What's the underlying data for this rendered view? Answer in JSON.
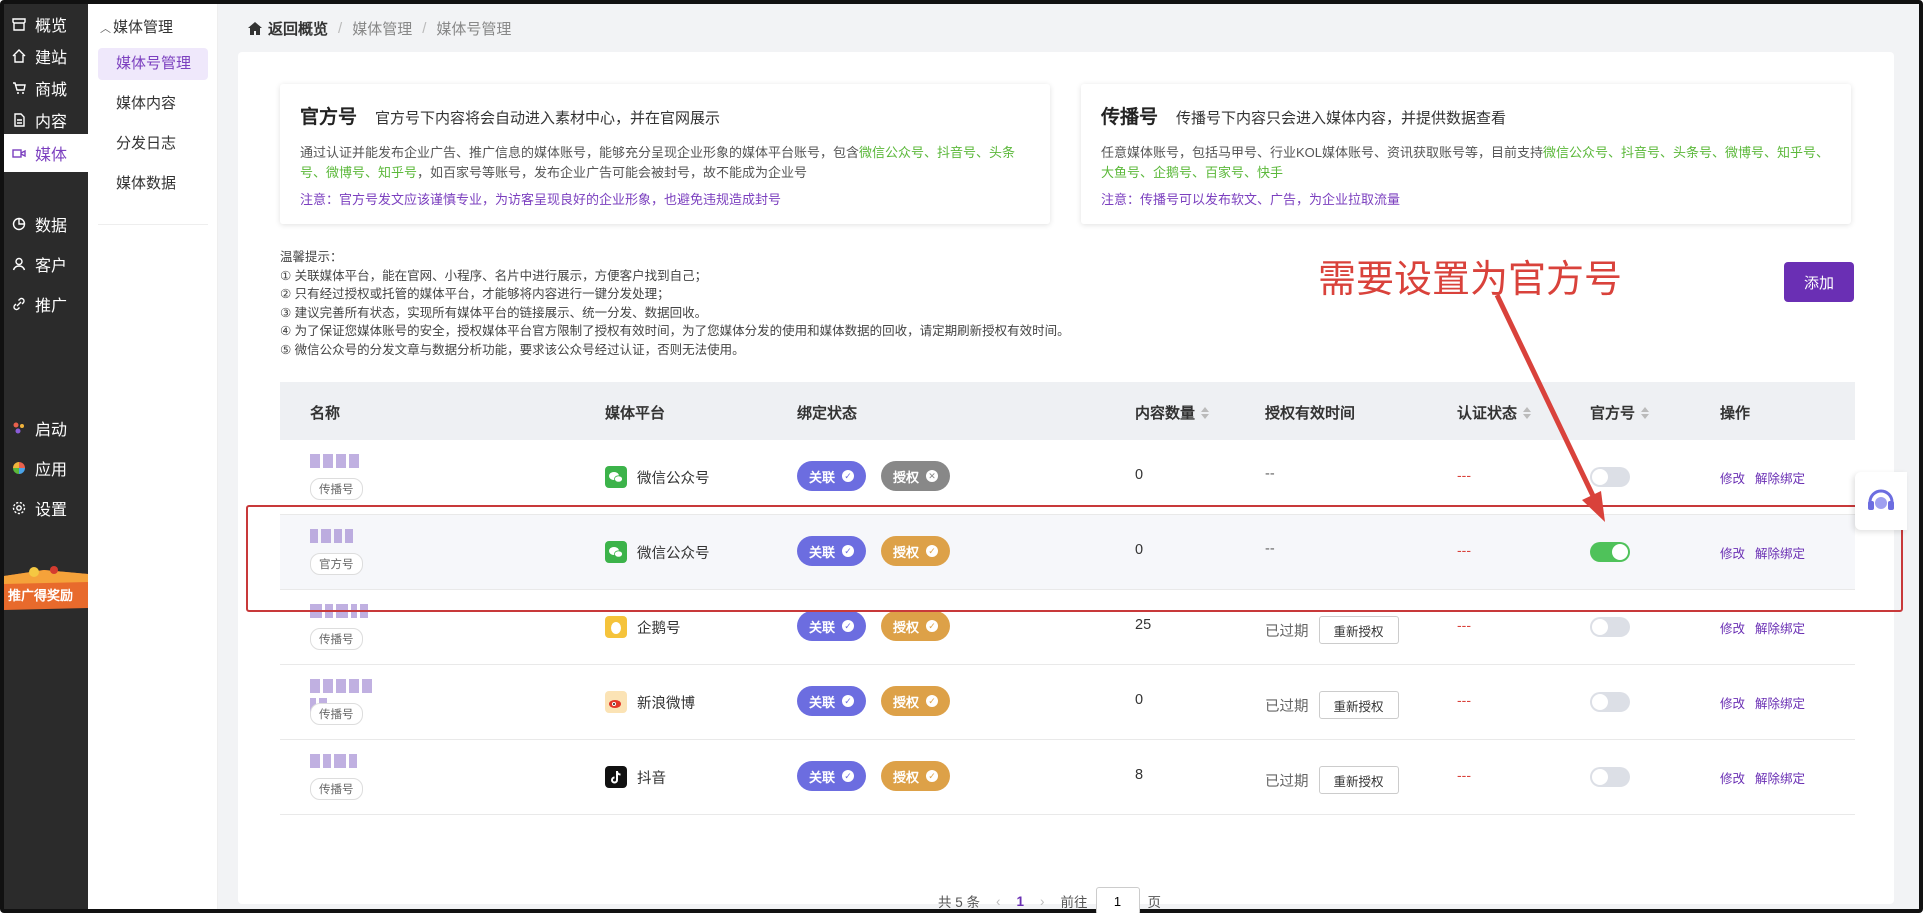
{
  "sidebar": {
    "items": [
      {
        "label": "概览",
        "icon": "storefront-icon"
      },
      {
        "label": "建站",
        "icon": "home-icon"
      },
      {
        "label": "商城",
        "icon": "cart-icon"
      },
      {
        "label": "内容",
        "icon": "document-icon"
      },
      {
        "label": "媒体",
        "icon": "video-icon",
        "active": true
      },
      {
        "label": "数据",
        "icon": "pie-chart-icon"
      },
      {
        "label": "客户",
        "icon": "user-icon"
      },
      {
        "label": "推广",
        "icon": "link-icon"
      }
    ],
    "bottom_items": [
      {
        "label": "启动",
        "icon": "launch-icon"
      },
      {
        "label": "应用",
        "icon": "apps-icon"
      },
      {
        "label": "设置",
        "icon": "gear-icon"
      }
    ],
    "promo_text": "推广得奖励"
  },
  "submenu": {
    "header": "媒体管理",
    "items": [
      "媒体号管理",
      "媒体内容",
      "分发日志",
      "媒体数据"
    ]
  },
  "breadcrumb": {
    "home": "返回概览",
    "level1": "媒体管理",
    "level2": "媒体号管理"
  },
  "cards": {
    "official": {
      "title": "官方号",
      "subtitle": "官方号下内容将会自动进入素材中心，并在官网展示",
      "desc_pre": "通过认证并能发布企业广告、推广信息的媒体账号，能够充分呈现企业形象的媒体平台账号，包含",
      "desc_green": "微信公众号、抖音号、头条号、微博号、知乎号",
      "desc_post": "，如百家号等账号，发布企业广告可能会被封号，故不能成为企业号",
      "note": "注意：官方号发文应该谨慎专业，为访客呈现良好的企业形象，也避免违规造成封号"
    },
    "broadcast": {
      "title": "传播号",
      "subtitle": "传播号下内容只会进入媒体内容，并提供数据查看",
      "desc_pre": "任意媒体账号，包括马甲号、行业KOL媒体账号、资讯获取账号等，目前支持",
      "desc_green": "微信公众号、抖音号、头条号、微博号、知乎号、大鱼号、企鹅号、百家号、快手",
      "note": "注意：传播号可以发布软文、广告，为企业拉取流量"
    }
  },
  "tips": {
    "title": "温馨提示：",
    "lines": [
      "① 关联媒体平台，能在官网、小程序、名片中进行展示，方便客户找到自己；",
      "② 只有经过授权或托管的媒体平台，才能够将内容进行一键分发处理；",
      "③ 建议完善所有状态，实现所有媒体平台的链接展示、统一分发、数据回收。",
      "④ 为了保证您媒体账号的安全，授权媒体平台官方限制了授权有效时间，为了您媒体分发的使用和媒体数据的回收，请定期刷新授权有效时间。",
      "⑤ 微信公众号的分发文章与数据分析功能，要求该公众号经过认证，否则无法使用。"
    ]
  },
  "add_button": "添加",
  "annotation": "需要设置为官方号",
  "table": {
    "headers": {
      "name": "名称",
      "platform": "媒体平台",
      "bind": "绑定状态",
      "count": "内容数量",
      "auth_time": "授权有效时间",
      "verify": "认证状态",
      "official": "官方号",
      "ops": "操作"
    },
    "rows": [
      {
        "tag": "传播号",
        "platform": "微信公众号",
        "platform_icon": "wechat-icon",
        "link_label": "关联",
        "auth_label": "授权",
        "auth_state": "failed",
        "count": "0",
        "auth_time": "--",
        "expired": false,
        "verify": "---",
        "official_on": false,
        "edit": "修改",
        "unbind": "解除绑定"
      },
      {
        "tag": "官方号",
        "platform": "微信公众号",
        "platform_icon": "wechat-icon",
        "link_label": "关联",
        "auth_label": "授权",
        "auth_state": "ok",
        "count": "0",
        "auth_time": "--",
        "expired": false,
        "verify": "---",
        "official_on": true,
        "edit": "修改",
        "unbind": "解除绑定"
      },
      {
        "tag": "传播号",
        "platform": "企鹅号",
        "platform_icon": "penguin-icon",
        "link_label": "关联",
        "auth_label": "授权",
        "auth_state": "ok",
        "count": "25",
        "auth_time": "已过期",
        "expired": true,
        "reauth": "重新授权",
        "verify": "---",
        "official_on": false,
        "edit": "修改",
        "unbind": "解除绑定"
      },
      {
        "tag": "传播号",
        "platform": "新浪微博",
        "platform_icon": "weibo-icon",
        "link_label": "关联",
        "auth_label": "授权",
        "auth_state": "ok",
        "count": "0",
        "auth_time": "已过期",
        "expired": true,
        "reauth": "重新授权",
        "verify": "---",
        "official_on": false,
        "edit": "修改",
        "unbind": "解除绑定"
      },
      {
        "tag": "传播号",
        "platform": "抖音",
        "platform_icon": "tiktok-icon",
        "link_label": "关联",
        "auth_label": "授权",
        "auth_state": "ok",
        "count": "8",
        "auth_time": "已过期",
        "expired": true,
        "reauth": "重新授权",
        "verify": "---",
        "official_on": false,
        "edit": "修改",
        "unbind": "解除绑定"
      }
    ]
  },
  "pagination": {
    "total": "共 5 条",
    "current": "1",
    "goto_label": "前往",
    "goto_value": "1",
    "page_suffix": "页"
  },
  "colors": {
    "accent": "#6a2fb4",
    "link_pill": "#6c6de0",
    "auth_pill": "#dda148",
    "switch_on": "#4fc25a",
    "annotation": "#d9423b"
  }
}
